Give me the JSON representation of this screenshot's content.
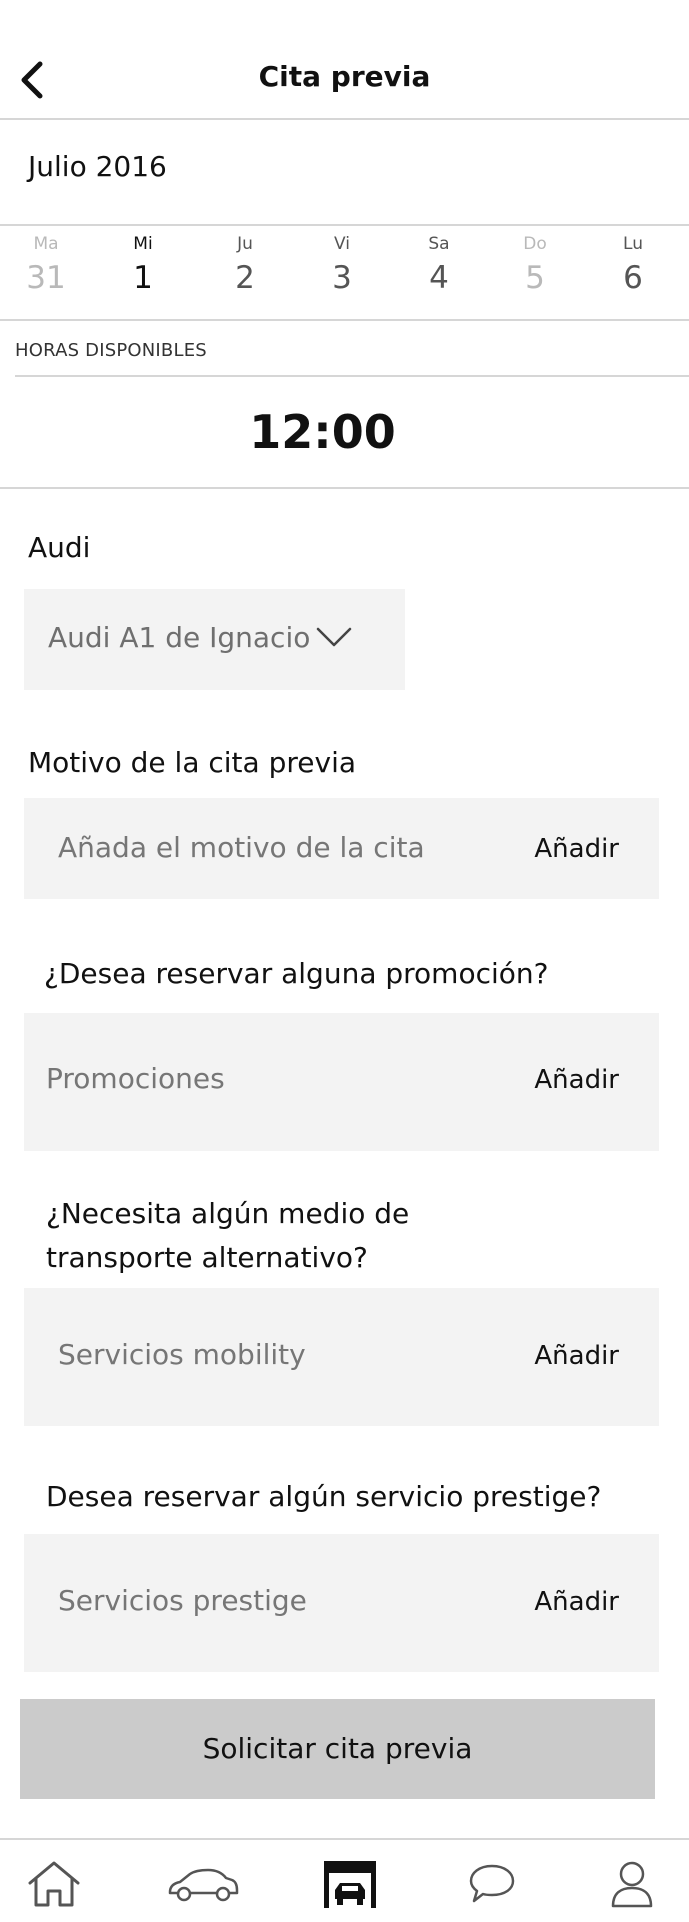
{
  "header": {
    "title": "Cita previa"
  },
  "calendar": {
    "month": "Julio 2016",
    "days": [
      {
        "name": "Ma",
        "num": "31"
      },
      {
        "name": "Mi",
        "num": "1"
      },
      {
        "name": "Ju",
        "num": "2"
      },
      {
        "name": "Vi",
        "num": "3"
      },
      {
        "name": "Sa",
        "num": "4"
      },
      {
        "name": "Do",
        "num": "5"
      },
      {
        "name": "Lu",
        "num": "6"
      }
    ]
  },
  "hours": {
    "label": "HORAS DISPONIBLES",
    "slots": [
      "12:00"
    ]
  },
  "vehicle": {
    "label": "Audi",
    "selected": "Audi A1 de Ignacio"
  },
  "reason": {
    "label": "Motivo de la cita previa",
    "placeholder": "Añada el motivo de la cita",
    "add": "Añadir"
  },
  "promo": {
    "label": "¿Desea reservar alguna promoción?",
    "placeholder": "Promociones",
    "add": "Añadir"
  },
  "mobility": {
    "label_line1": "¿Necesita algún medio de",
    "label_line2": "transporte alternativo?",
    "placeholder": "Servicios mobility",
    "add": "Añadir"
  },
  "prestige": {
    "label": "Desea reservar algún servicio prestige?",
    "placeholder": "Servicios prestige",
    "add": "Añadir"
  },
  "submit": {
    "label": "Solicitar cita previa"
  },
  "tabbar": {
    "items": [
      {
        "icon": "home-icon"
      },
      {
        "icon": "car-icon"
      },
      {
        "icon": "garage-icon",
        "active": true
      },
      {
        "icon": "chat-bubble-icon"
      },
      {
        "icon": "user-profile-icon"
      }
    ]
  }
}
